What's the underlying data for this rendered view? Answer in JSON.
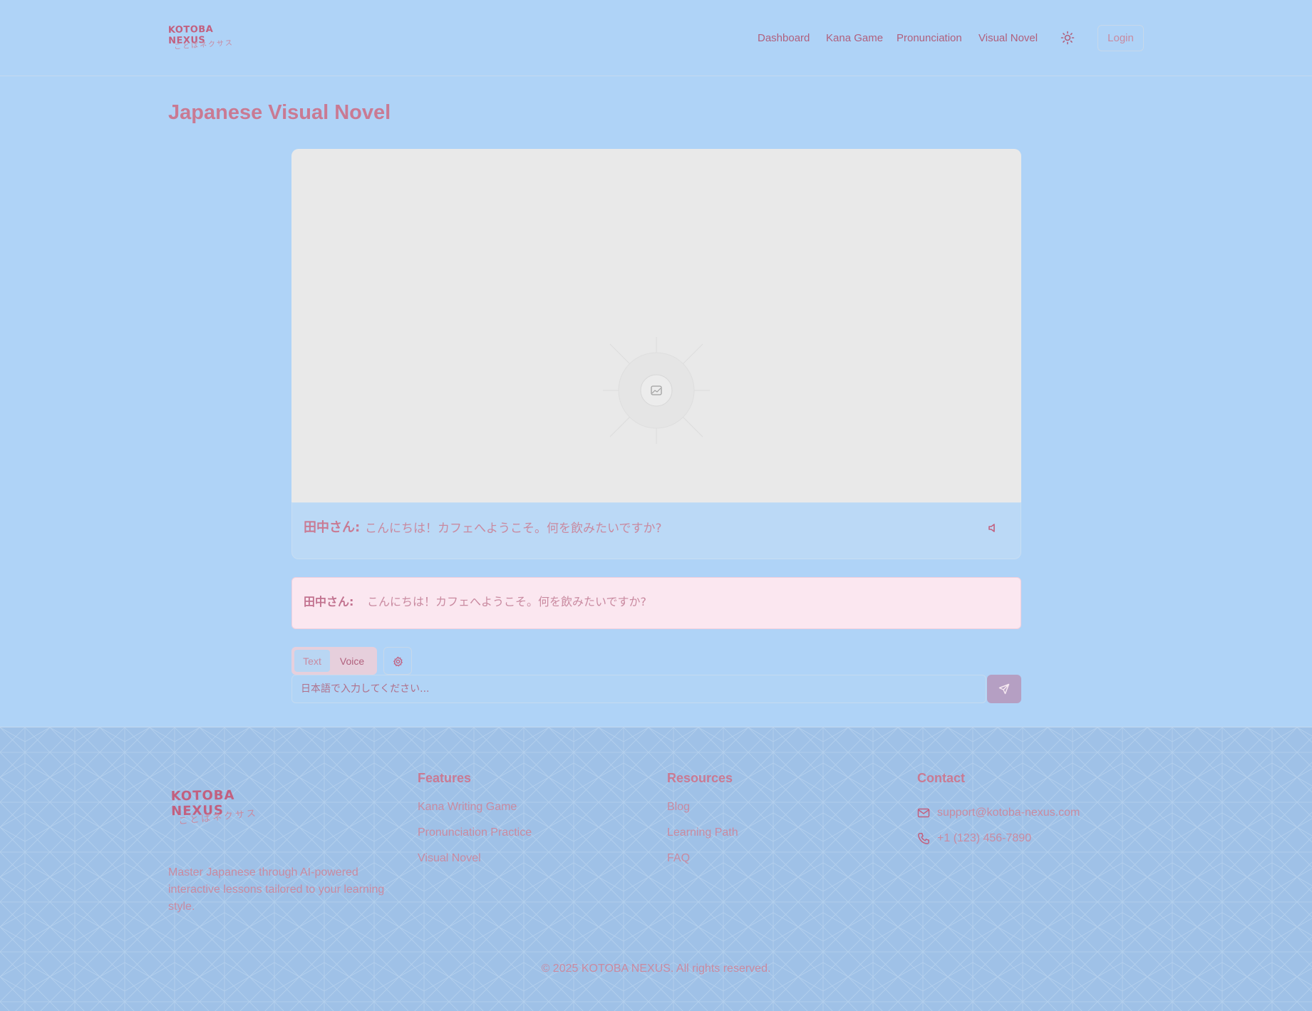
{
  "header": {
    "logo_text": "KOTOBA NEXUS",
    "logo_subtext": "ことばネクサス",
    "nav": [
      {
        "label": "Dashboard"
      },
      {
        "label": "Kana Game"
      },
      {
        "label": "Pronunciation"
      },
      {
        "label": "Visual Novel"
      }
    ],
    "login_label": "Login"
  },
  "main": {
    "title": "Japanese Visual Novel",
    "scene_icon": "image-placeholder-icon",
    "dialogue": {
      "speaker": "田中さん:",
      "text": "こんにちは！カフェへようこそ。何を飲みたいですか?"
    },
    "history": {
      "speaker": "田中さん:",
      "text": "こんにちは！カフェへようこそ。何を飲みたいですか?"
    },
    "input_mode": {
      "options": [
        "Text",
        "Voice"
      ],
      "selected": "Text"
    },
    "chat_input": {
      "placeholder": "日本語で入力してください..."
    }
  },
  "footer": {
    "logo_text": "KOTOBA NEXUS",
    "logo_subtext": "ことばネクサス",
    "description": "Master Japanese through AI-powered interactive lessons tailored to your learning style.",
    "features": {
      "heading": "Features",
      "links": [
        "Kana Writing Game",
        "Pronunciation Practice",
        "Visual Novel"
      ]
    },
    "resources": {
      "heading": "Resources",
      "links": [
        "Blog",
        "Learning Path",
        "FAQ"
      ]
    },
    "contact": {
      "heading": "Contact",
      "email": "support@kotoba-nexus.com",
      "phone": "+1 (123) 456-7890"
    },
    "copyright": "© 2025 KOTOBA NEXUS. All rights reserved."
  },
  "colors": {
    "background": "#afd3f7",
    "accent": "#c97a93",
    "footer_bg": "#9fc1e7",
    "scene_bg": "#e9e9e9",
    "history_bg": "#fbe7f0",
    "send_button": "#b59fc3"
  }
}
